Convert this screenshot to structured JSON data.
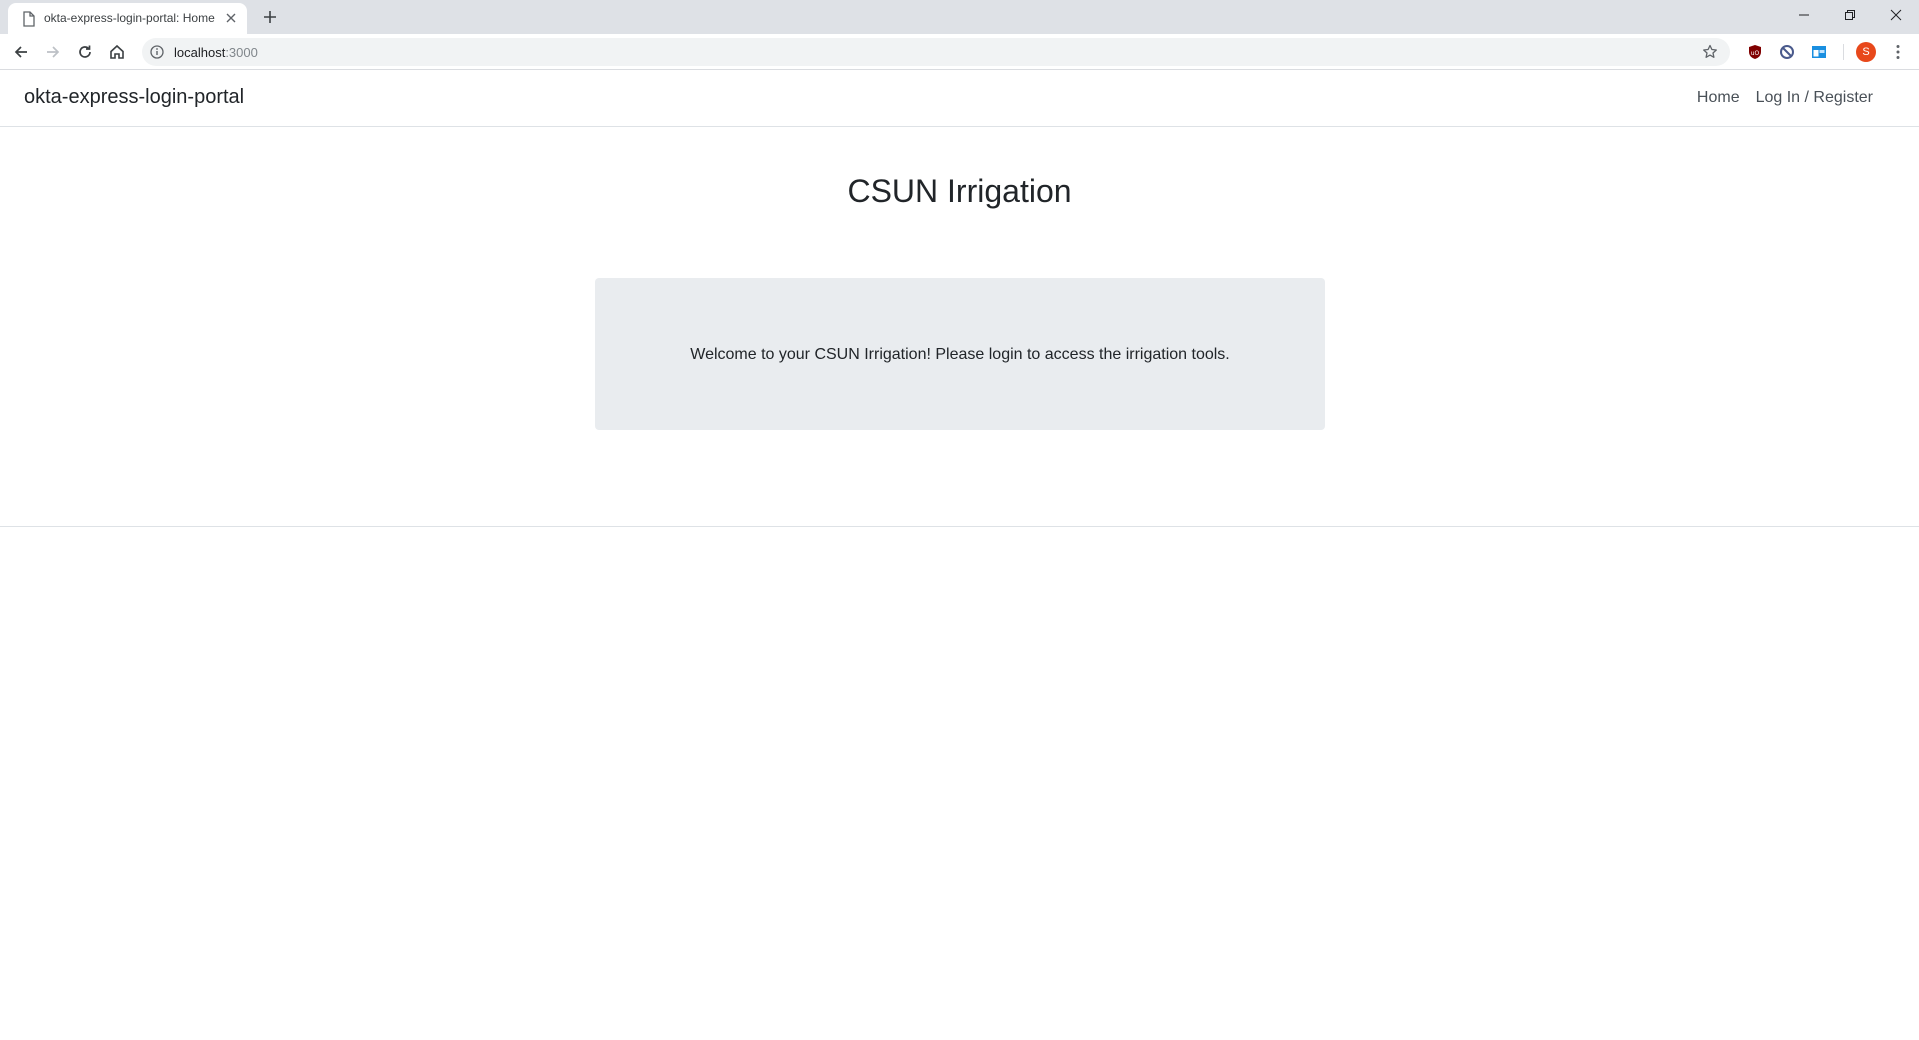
{
  "browser": {
    "tab_title": "okta-express-login-portal: Home",
    "url_host": "localhost",
    "url_port": ":3000",
    "profile_initial": "S",
    "icons": {
      "page": "page-icon",
      "close": "close-icon",
      "new_tab": "plus-icon",
      "back": "back-arrow-icon",
      "forward": "forward-arrow-icon",
      "reload": "reload-icon",
      "home": "home-icon",
      "info": "info-icon",
      "star": "star-icon",
      "menu": "kebab-menu-icon"
    },
    "extensions": [
      "ublock-shield-icon",
      "block-icon",
      "window-extension-icon"
    ]
  },
  "navbar": {
    "brand": "okta-express-login-portal",
    "links": [
      {
        "label": "Home"
      },
      {
        "label": "Log In / Register"
      }
    ]
  },
  "main": {
    "title": "CSUN Irrigation",
    "message": "Welcome to your CSUN Irrigation! Please login to access the irrigation tools."
  },
  "colors": {
    "jumbotron_bg": "#e9ecef",
    "avatar": "#e8481b",
    "chrome_tabstrip": "#dee1e6"
  }
}
